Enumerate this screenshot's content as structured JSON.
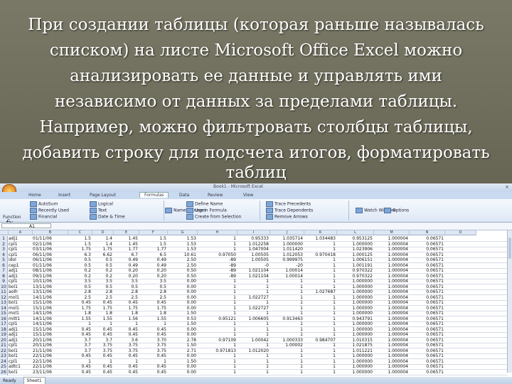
{
  "caption": {
    "lines": [
      "При создании таблицы (которая раньше называлась",
      "списком) на листе Microsoft Office Excel можно",
      "анализировать ее данные и управлять ими",
      "независимо от данных за пределами таблицы.",
      "Например, можно фильтровать столбцы таблицы,",
      "добавить строку для подсчета итогов, форматировать",
      "таблиц"
    ]
  },
  "excel": {
    "title": "Book1 - Microsoft Excel",
    "close_glyph": "×",
    "tabs": [
      "Home",
      "Insert",
      "Page Layout",
      "Formulas",
      "Data",
      "Review",
      "View"
    ],
    "active_tab": "Formulas",
    "ribbon": {
      "insert_function": "Function",
      "items": [
        "AutoSum",
        "Recently Used",
        "Financial",
        "Logical",
        "Text",
        "Date & Time",
        "Name Manager",
        "Define Name",
        "Use in Formula",
        "Create from Selection",
        "Trace Precedents",
        "Trace Dependents",
        "Remove Arrows",
        "Watch Window",
        "Options"
      ]
    },
    "name_box": "A1",
    "columns": [
      "A",
      "B",
      "C",
      "D",
      "E",
      "F",
      "G",
      "H",
      "I",
      "J",
      "K",
      "L",
      "M",
      "N",
      "O"
    ],
    "rows": [
      [
        "1",
        "adj1",
        "01/11/06",
        "1.5",
        "1.4",
        "1.45",
        "1.5",
        "1.53",
        "1",
        "0.95333",
        "1.035714",
        "1.034483",
        "0.953125",
        "1.000004",
        "0.06571"
      ],
      [
        "2",
        "cpl1",
        "02/11/06",
        "1.5",
        "1.4",
        "1.45",
        "1.5",
        "1.53",
        "1",
        "1.012258",
        "1.000000",
        "1",
        "1.000000",
        "1.000004",
        "0.06571"
      ],
      [
        "3",
        "cpl1",
        "03/11/06",
        "1.75",
        "1.75",
        "1.77",
        "1.77",
        "1.53",
        "1",
        "1.047004",
        "1.011420",
        "1",
        "1.023906",
        "1.000004",
        "0.06571"
      ],
      [
        "4",
        "cpl1",
        "06/11/06",
        "6.3",
        "6.62",
        "6.7",
        "6.5",
        "10.61",
        "0.97050",
        "1.00505",
        "1.012053",
        "0.970418",
        "1.000125",
        "1.000004",
        "0.06571"
      ],
      [
        "5",
        "idol",
        "06/11/06",
        "0.5",
        "0.5",
        "0.49",
        "0.49",
        "2.50",
        "-89",
        "1.00505",
        "0.999975",
        "1",
        "1.006151",
        "1.000004",
        "0.06571"
      ],
      [
        "6",
        "cep1",
        "01/11/06",
        "0.5",
        "0.5",
        "0.49",
        "0.49",
        "2.50",
        "-89",
        "-0",
        "-20",
        "1",
        "1.001191",
        "1.000004",
        "0.06571"
      ],
      [
        "7",
        "adj1",
        "08/11/06",
        "0.2",
        "0.2",
        "0.20",
        "0.20",
        "0.50",
        "-89",
        "1.021104",
        "1.00014",
        "1",
        "0.970322",
        "1.000004",
        "0.06571"
      ],
      [
        "8",
        "adj1",
        "09/11/06",
        "0.2",
        "0.2",
        "0.20",
        "0.20",
        "0.50",
        "-89",
        "1.021104",
        "1.00014",
        "1",
        "0.970322",
        "1.000004",
        "0.06571"
      ],
      [
        "9",
        "cpl1",
        "10/11/06",
        "3.5",
        "3.5",
        "3.5",
        "3.5",
        "0.00",
        "1",
        "1",
        "1",
        "1",
        "1.000000",
        "1.000004",
        "0.06571"
      ],
      [
        "10",
        "bol1",
        "13/11/06",
        "0.5",
        "0.5",
        "0.5",
        "0.5",
        "0.00",
        "1",
        "1",
        "1",
        "1",
        "1.000000",
        "1.000004",
        "0.06571"
      ],
      [
        "11",
        "aolh",
        "13/11/06",
        "2.8",
        "2.8",
        "2.8",
        "2.8",
        "0.00",
        "1",
        "1",
        "1",
        "1.027687",
        "1.000000",
        "1.000004",
        "0.06571"
      ],
      [
        "12",
        "mol1",
        "14/11/06",
        "2.5",
        "2.5",
        "2.5",
        "2.5",
        "0.00",
        "1",
        "1.022727",
        "1",
        "1",
        "1.000000",
        "1.000004",
        "0.06571"
      ],
      [
        "13",
        "bol1",
        "15/11/06",
        "0.45",
        "0.45",
        "0.45",
        "0.45",
        "0.00",
        "1",
        "1",
        "1",
        "1",
        "1.000000",
        "1.000004",
        "0.06571"
      ],
      [
        "14",
        "mol1",
        "15/11/06",
        "1.75",
        "1.75",
        "1.75",
        "1.75",
        "0.00",
        "1",
        "1.022727",
        "1",
        "1",
        "1.000000",
        "1.000004",
        "0.06571"
      ],
      [
        "15",
        "mol1",
        "14/11/06",
        "1.8",
        "1.8",
        "1.8",
        "1.8",
        "1.50",
        "1",
        "1",
        "1",
        "1",
        "1.000000",
        "1.000004",
        "0.06571"
      ],
      [
        "16",
        "mitt1",
        "14/11/06",
        "1.55",
        "1.55",
        "1.56",
        "1.55",
        "0.53",
        "0.95121",
        "1.006605",
        "0.913463",
        "1",
        "0.943791",
        "1.000004",
        "0.06571"
      ],
      [
        "17",
        "cpl1",
        "14/11/06",
        "1",
        "1",
        "1",
        "1",
        "1.50",
        "1",
        "1",
        "1",
        "1",
        "1.000000",
        "1.000004",
        "0.06571"
      ],
      [
        "18",
        "adj1",
        "15/11/06",
        "0.45",
        "0.45",
        "0.45",
        "0.45",
        "0.00",
        "1",
        "1",
        "1",
        "1",
        "1.000000",
        "1.000004",
        "0.06571"
      ],
      [
        "19",
        "adj1",
        "15/11/06",
        "0.45",
        "0.45",
        "0.45",
        "0.45",
        "0.00",
        "1",
        "1",
        "1",
        "1",
        "1.000000",
        "1.000004",
        "0.06571"
      ],
      [
        "20",
        "adj1",
        "20/11/06",
        "3.7",
        "3.7",
        "3.6",
        "3.70",
        "2.78",
        "0.97109",
        "1.00042",
        "1.000333",
        "0.984707",
        "1.010315",
        "1.000004",
        "0.06571"
      ],
      [
        "21",
        "cpl1",
        "20/11/06",
        "3.7",
        "3.75",
        "3.75",
        "3.75",
        "1.50",
        "1",
        "1",
        "1.00002",
        "1",
        "1.021875",
        "1.000004",
        "0.06571"
      ],
      [
        "22",
        "bol1",
        "21/11/06",
        "3.7",
        "3.75",
        "3.75",
        "3.75",
        "2.71",
        "0.971813",
        "1.012020",
        "1",
        "1",
        "1.011221",
        "1.000004",
        "0.06571"
      ],
      [
        "23",
        "bol1",
        "22/11/06",
        "0.45",
        "0.45",
        "0.45",
        "0.45",
        "0.00",
        "1",
        "1",
        "1",
        "1",
        "1.000000",
        "1.000004",
        "0.06571"
      ],
      [
        "24",
        "cpl1",
        "22/11/06",
        "1",
        "1",
        "1",
        "1",
        "1.50",
        "1",
        "1",
        "1",
        "1",
        "1.000000",
        "1.000004",
        "0.06571"
      ],
      [
        "25",
        "adtc1",
        "22/11/06",
        "0.45",
        "0.45",
        "0.45",
        "0.45",
        "0.00",
        "1",
        "1",
        "1",
        "1",
        "1.000000",
        "1.000004",
        "0.06571"
      ],
      [
        "26",
        "bol1",
        "23/11/06",
        "0.45",
        "0.45",
        "0.45",
        "0.45",
        "0.00",
        "1",
        "1",
        "1",
        "1",
        "1.000000",
        "1.000004",
        "0.06571"
      ]
    ],
    "status": "Ready",
    "sheet_tab": "Sheet1"
  }
}
